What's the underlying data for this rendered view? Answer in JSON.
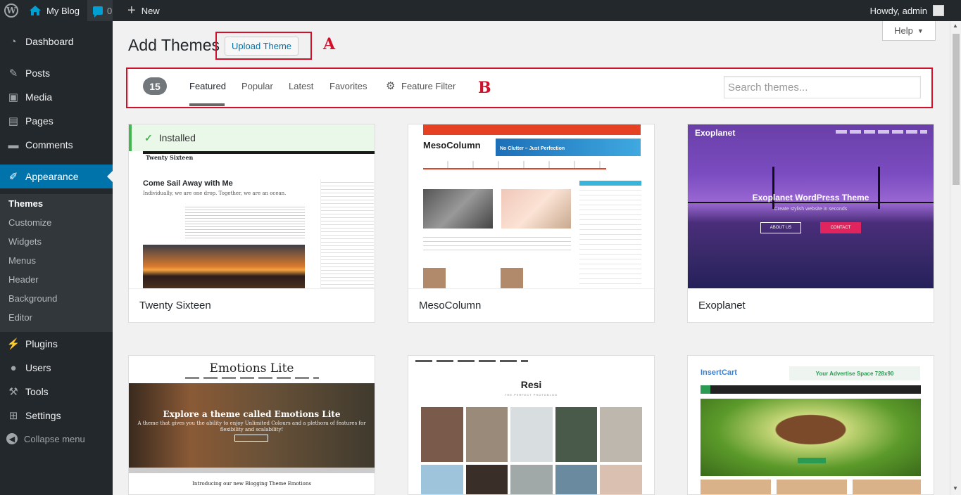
{
  "adminbar": {
    "site_name": "My Blog",
    "comments_count": "0",
    "new_label": "New",
    "howdy": "Howdy, admin"
  },
  "sidebar": {
    "items": [
      {
        "label": "Dashboard",
        "icon": "dashboard-icon"
      },
      {
        "label": "Posts",
        "icon": "pin-icon"
      },
      {
        "label": "Media",
        "icon": "media-icon"
      },
      {
        "label": "Pages",
        "icon": "pages-icon"
      },
      {
        "label": "Comments",
        "icon": "comment-icon"
      },
      {
        "label": "Appearance",
        "icon": "brush-icon"
      },
      {
        "label": "Plugins",
        "icon": "plug-icon"
      },
      {
        "label": "Users",
        "icon": "user-icon"
      },
      {
        "label": "Tools",
        "icon": "wrench-icon"
      },
      {
        "label": "Settings",
        "icon": "settings-icon"
      }
    ],
    "submenu": [
      "Themes",
      "Customize",
      "Widgets",
      "Menus",
      "Header",
      "Background",
      "Editor"
    ],
    "collapse_label": "Collapse menu"
  },
  "header": {
    "title": "Add Themes",
    "upload_button": "Upload Theme",
    "help_button": "Help",
    "annotation_a": "A",
    "annotation_b": "B"
  },
  "filter": {
    "count": "15",
    "tabs": [
      "Featured",
      "Popular",
      "Latest",
      "Favorites",
      "Feature Filter"
    ],
    "active_tab": "Featured",
    "search_placeholder": "Search themes..."
  },
  "themes": [
    {
      "name": "Twenty Sixteen",
      "installed": true,
      "installed_label": "Installed",
      "preview": {
        "site_title": "Twenty Sixteen",
        "headline": "Come Sail Away with Me",
        "tagline": "Individually, we are one drop. Together, we are an ocean."
      }
    },
    {
      "name": "MesoColumn",
      "preview": {
        "site_title": "MesoColumn",
        "banner": "No Clutter – Just Perfection"
      }
    },
    {
      "name": "Exoplanet",
      "preview": {
        "logo": "Exoplanet",
        "headline": "Exoplanet WordPress Theme",
        "sub": "Create stylish website in seconds",
        "button1": "ABOUT US",
        "button2": "CONTACT"
      }
    },
    {
      "name": "Emotions Lite",
      "preview": {
        "site_title": "Emotions Lite",
        "headline": "Explore a theme called Emotions Lite",
        "sub": "A theme that gives you the ability to enjoy Unlimited Colours and a plethora of features for flexibility and scalability!",
        "intro": "Introducing our new Blogging Theme Emotions"
      }
    },
    {
      "name": "Resi",
      "preview": {
        "site_title": "Resi",
        "sub": "THE PERFECT PHOTOBLOG"
      }
    },
    {
      "name": "InsertCart",
      "preview": {
        "logo": "InsertCart",
        "ad": "Your Advertise Space 728x90"
      }
    }
  ],
  "colors": {
    "accent": "#0073aa",
    "adminbar": "#23282d",
    "annotation": "#d0112b",
    "installed": "#46b450"
  }
}
